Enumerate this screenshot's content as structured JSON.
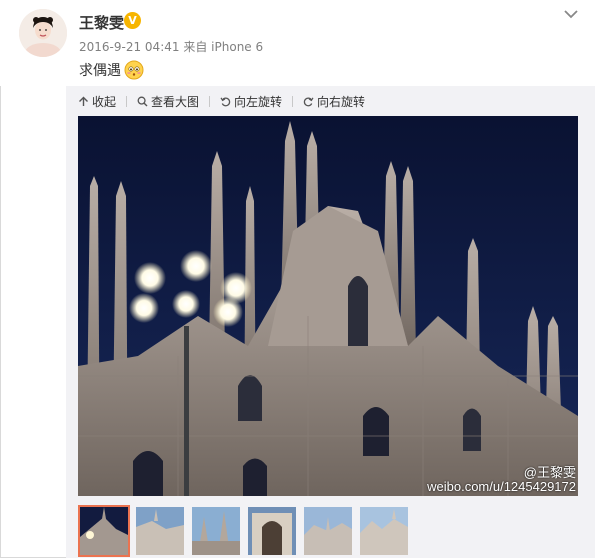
{
  "post": {
    "username": "王黎雯",
    "vip_badge": "V",
    "timestamp": "2016-9-21 04:41",
    "source_prefix": "来自",
    "device": "iPhone 6",
    "text": "求偶遇",
    "emoji_icon": "shy-face-emoji-icon"
  },
  "toolbar": {
    "collapse_label": "收起",
    "view_large_label": "查看大图",
    "rotate_left_label": "向左旋转",
    "rotate_right_label": "向右旋转"
  },
  "photo": {
    "watermark_user": "@王黎雯",
    "watermark_url": "weibo.com/u/1245429172"
  },
  "thumbnails": {
    "count": 6,
    "selected_index": 0
  },
  "colors": {
    "vip_badge": "#f7b500",
    "link": "#eb7350",
    "sky": "#0e1838"
  }
}
